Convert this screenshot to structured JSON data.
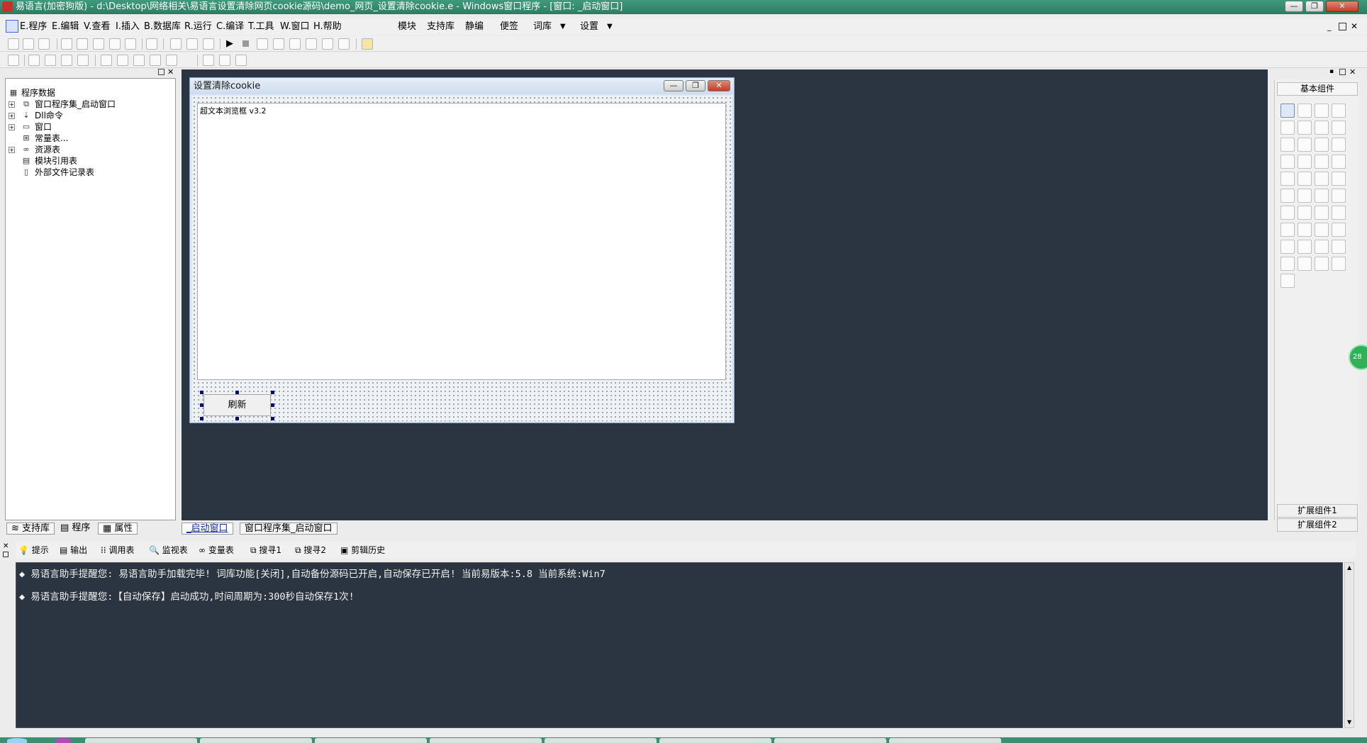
{
  "window": {
    "title": "易语言(加密狗版) - d:\\Desktop\\网络相关\\易语言设置清除网页cookie源码\\demo_网页_设置清除cookie.e - Windows窗口程序 - [窗口: _启动窗口]",
    "minimize_label": "—",
    "restore_label": "❐",
    "close_label": "✕"
  },
  "menu": {
    "items": [
      {
        "label": "E.程序"
      },
      {
        "label": "E.编辑"
      },
      {
        "label": "V.查看"
      },
      {
        "label": "I.插入"
      },
      {
        "label": "B.数据库"
      },
      {
        "label": "R.运行"
      },
      {
        "label": "C.编译"
      },
      {
        "label": "T.工具"
      },
      {
        "label": "W.窗口"
      },
      {
        "label": "H.帮助"
      }
    ],
    "extra": [
      {
        "label": "模块"
      },
      {
        "label": "支持库"
      },
      {
        "label": "静编"
      },
      {
        "label": "便签"
      },
      {
        "label": "词库"
      },
      {
        "label": "设置"
      }
    ],
    "dropdown_icon": "chevron-down-icon"
  },
  "tree": {
    "root": "程序数据",
    "items": [
      {
        "label": "窗口程序集_启动窗口",
        "expandable": true,
        "icon": "window-class-icon"
      },
      {
        "label": "Dll命令",
        "expandable": true,
        "icon": "dll-icon"
      },
      {
        "label": "窗口",
        "expandable": true,
        "icon": "window-icon"
      },
      {
        "label": "常量表...",
        "expandable": false,
        "icon": "constant-table-icon"
      },
      {
        "label": "资源表",
        "expandable": true,
        "icon": "resource-icon"
      },
      {
        "label": "模块引用表",
        "expandable": false,
        "icon": "module-ref-icon"
      },
      {
        "label": "外部文件记录表",
        "expandable": false,
        "icon": "file-record-icon"
      }
    ]
  },
  "left_tabs": [
    {
      "label": "支持库"
    },
    {
      "label": "程序"
    },
    {
      "label": "属性"
    }
  ],
  "editor_tabs": [
    {
      "label": "_启动窗口",
      "active": true
    },
    {
      "label": "窗口程序集_启动窗口",
      "active": false
    }
  ],
  "design_window": {
    "title": "设置清除cookie",
    "browser_label": "超文本浏览框 v3.2",
    "button_label": "刷新"
  },
  "right_panel": {
    "header": "基本组件",
    "ext1": "扩展组件1",
    "ext2": "扩展组件2"
  },
  "output_tabs": [
    {
      "label": "提示"
    },
    {
      "label": "输出"
    },
    {
      "label": "调用表"
    },
    {
      "label": "监视表"
    },
    {
      "label": "变量表"
    },
    {
      "label": "搜寻1"
    },
    {
      "label": "搜寻2"
    },
    {
      "label": "剪辑历史"
    }
  ],
  "output_lines": [
    {
      "text": "◆ 易语言助手提醒您:  易语言助手加载完毕!  词库功能[关闭],自动备份源码已开启,自动保存已开启!  当前易版本:5.8  当前系统:Win7"
    },
    {
      "text": "◆ 易语言助手提醒您:【自动保存】启动成功,时间周期为:300秒自动保存1次!"
    }
  ],
  "badge": {
    "text": "28"
  },
  "colors": {
    "titlebar": "#2c7d62",
    "workspace": "#2b3441",
    "design_window_frame": "#dbe7f3",
    "selection_handle": "#00107a"
  }
}
